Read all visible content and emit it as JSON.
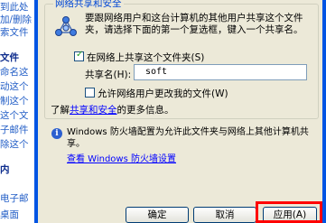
{
  "left_pane": {
    "lines": [
      "到此处",
      "加/删除",
      "索文件",
      "",
      "文件",
      "命名这",
      "动这个",
      "制这个",
      "这个文",
      "子邮件",
      "除这个",
      "",
      "内",
      "电子邮",
      "桌面"
    ]
  },
  "sharing_group": {
    "legend": "网络共享和安全",
    "description": "要跟网络用户和这台计算机的其他用户共享这个文件夹，请选择下面的第一个复选框，键入一个共享名。",
    "share_checkbox_label": "在网络上共享这个文件夹(S)",
    "share_checked": true,
    "share_name_label": "共享名(H):",
    "share_name_value": "soft",
    "allow_change_label": "允许网络用户更改我的文件(W)",
    "allow_change_checked": false,
    "learn_prefix": "了解",
    "learn_link": "共享和安全",
    "learn_suffix": "的更多信息。"
  },
  "firewall": {
    "text": "Windows 防火墙配置为允许此文件夹与网络上其他计算机共享。",
    "link": "查看 Windows 防火墙设置"
  },
  "buttons": {
    "ok": "确定",
    "cancel": "取消",
    "apply": "应用(A)"
  },
  "colors": {
    "dialog_bg": "#ece9d8",
    "highlight": "#ff0000",
    "link": "#0000ff"
  }
}
